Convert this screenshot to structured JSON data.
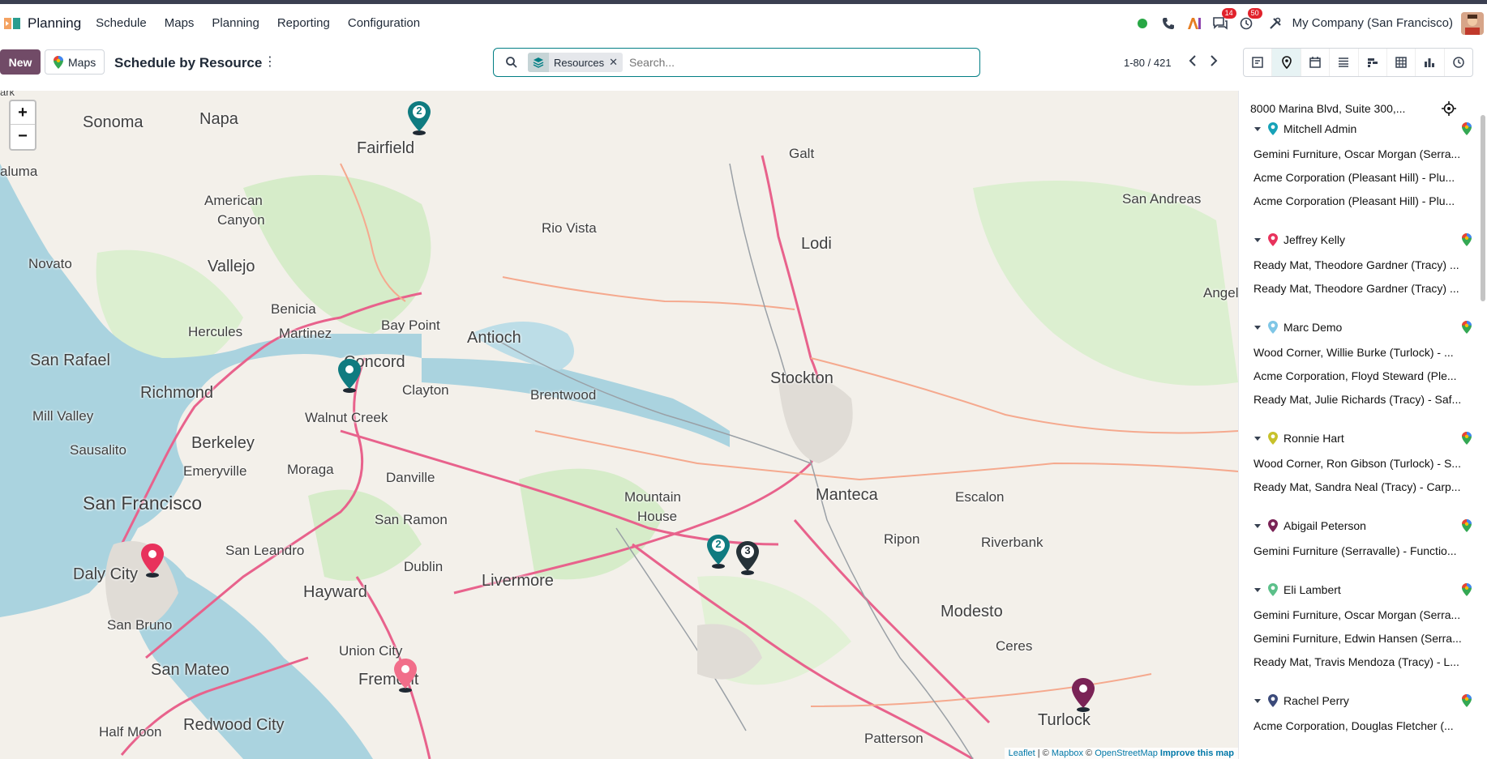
{
  "navbar": {
    "app_name": "Planning",
    "menu": [
      "Schedule",
      "Maps",
      "Planning",
      "Reporting",
      "Configuration"
    ],
    "badges": {
      "messages": "14",
      "activities": "50"
    },
    "company": "My Company (San Francisco)",
    "status_color": "#28a745"
  },
  "control_panel": {
    "new_label": "New",
    "maps_label": "Maps",
    "title": "Schedule by Resource",
    "facet_value": "Resources",
    "search_placeholder": "Search...",
    "pager": "1-80 / 421",
    "active_view": "map"
  },
  "map": {
    "zoom_in": "+",
    "zoom_out": "−",
    "attribution": {
      "leaflet": "Leaflet",
      "sep": " | © ",
      "mapbox": "Mapbox",
      "sep2": " © ",
      "osm": "OpenStreetMap",
      "improve": "Improve this map"
    },
    "labels": [
      "Sonoma",
      "Napa",
      "Fairfield",
      "Galt",
      "San Andreas",
      "American",
      "Canyon",
      "Rio Vista",
      "Lodi",
      "Novato",
      "Vallejo",
      "Benicia",
      "Hercules",
      "Martinez",
      "Bay Point",
      "Antioch",
      "San Rafael",
      "Concord",
      "Richmond",
      "Clayton",
      "Brentwood",
      "Stockton",
      "Mill Valley",
      "Walnut Creek",
      "Berkeley",
      "Sausalito",
      "Emeryville",
      "Moraga",
      "Danville",
      "San Francisco",
      "San Ramon",
      "Mountain",
      "House",
      "Manteca",
      "Escalon",
      "Ripon",
      "Riverbank",
      "San Leandro",
      "Dublin",
      "Daly City",
      "Hayward",
      "Livermore",
      "San Bruno",
      "Modesto",
      "Ceres",
      "Union City",
      "San Mateo",
      "Fremont",
      "Half Moon",
      "Redwood City",
      "Turlock",
      "Patterson",
      "Angel",
      "aluma",
      "ark"
    ],
    "cluster_counts": [
      "2",
      "2",
      "3"
    ],
    "pin_colors": {
      "teal": "#0f7b80",
      "pink": "#e8325c",
      "lightpink": "#f16e8a",
      "purple": "#7a2356",
      "dark": "#263238"
    }
  },
  "sidebar": {
    "address": "8000 Marina Blvd, Suite 300,...",
    "groups": [
      {
        "name": "Mitchell Admin",
        "color": "#17a2b8",
        "records": [
          "Gemini Furniture, Oscar Morgan (Serra...",
          "Acme Corporation (Pleasant Hill) - Plu...",
          "Acme Corporation (Pleasant Hill) - Plu..."
        ]
      },
      {
        "name": "Jeffrey Kelly",
        "color": "#e8325c",
        "records": [
          "Ready Mat, Theodore Gardner (Tracy) ...",
          "Ready Mat, Theodore Gardner (Tracy) ..."
        ]
      },
      {
        "name": "Marc Demo",
        "color": "#7fc6e6",
        "records": [
          "Wood Corner, Willie Burke (Turlock) - ...",
          "Acme Corporation, Floyd Steward (Ple...",
          "Ready Mat, Julie Richards (Tracy) - Saf..."
        ]
      },
      {
        "name": "Ronnie Hart",
        "color": "#c7c12b",
        "records": [
          "Wood Corner, Ron Gibson (Turlock) - S...",
          "Ready Mat, Sandra Neal (Tracy) - Carp..."
        ]
      },
      {
        "name": "Abigail Peterson",
        "color": "#7a2356",
        "records": [
          "Gemini Furniture (Serravalle) - Functio..."
        ]
      },
      {
        "name": "Eli Lambert",
        "color": "#5cc08a",
        "records": [
          "Gemini Furniture, Oscar Morgan (Serra...",
          "Gemini Furniture, Edwin Hansen (Serra...",
          "Ready Mat, Travis Mendoza (Tracy) - L..."
        ]
      },
      {
        "name": "Rachel Perry",
        "color": "#3b4a7a",
        "records": [
          "Acme Corporation, Douglas Fletcher (..."
        ]
      }
    ]
  }
}
